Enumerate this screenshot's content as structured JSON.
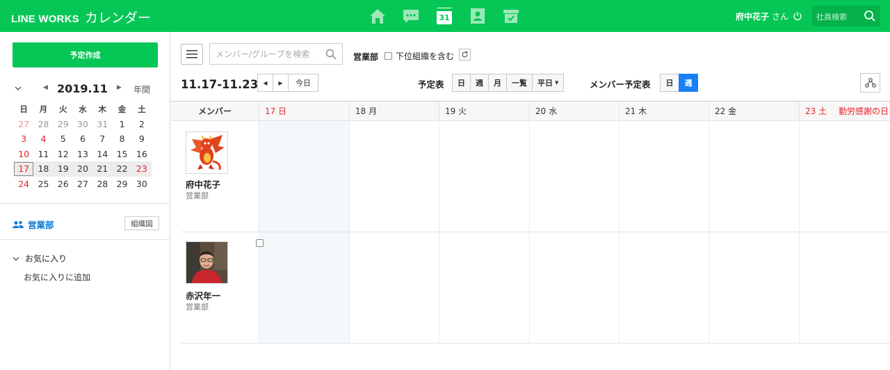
{
  "header": {
    "logo": "LINE WORKS",
    "app_title": "カレンダー",
    "calendar_icon_day": "31",
    "user_name": "府中花子",
    "user_suffix": "さん",
    "search_placeholder": "社員検索"
  },
  "sidebar": {
    "create_button": "予定作成",
    "mini_calendar": {
      "month_label": "2019.11",
      "year_view_label": "年間",
      "weekday_headers": [
        "日",
        "月",
        "火",
        "水",
        "木",
        "金",
        "土"
      ],
      "weeks": [
        [
          "27",
          "28",
          "29",
          "30",
          "31",
          "1",
          "2"
        ],
        [
          "3",
          "4",
          "5",
          "6",
          "7",
          "8",
          "9"
        ],
        [
          "10",
          "11",
          "12",
          "13",
          "14",
          "15",
          "16"
        ],
        [
          "17",
          "18",
          "19",
          "20",
          "21",
          "22",
          "23"
        ],
        [
          "24",
          "25",
          "26",
          "27",
          "28",
          "29",
          "30"
        ]
      ],
      "today": "17"
    },
    "department": "営業部",
    "org_chart_button": "組織図",
    "favorites_label": "お気に入り",
    "add_favorite": "お気に入りに追加"
  },
  "toolbar": {
    "member_search_placeholder": "メンバー/グループを検索",
    "department_label": "営業部",
    "include_sub_label": "下位組織を含む",
    "date_range": "11.17-11.23",
    "today_button": "今日",
    "schedule_label": "予定表",
    "view_buttons": [
      "日",
      "週",
      "月",
      "一覧",
      "平日"
    ],
    "member_schedule_label": "メンバー予定表",
    "member_view_buttons": [
      "日",
      "週"
    ],
    "member_view_active": "週"
  },
  "grid": {
    "member_header": "メンバー",
    "days": [
      "17 日",
      "18 月",
      "19 火",
      "20 水",
      "21 木",
      "22 金",
      "23 土"
    ],
    "holiday_label": "勤労感謝の日",
    "members": [
      {
        "name": "府中花子",
        "department": "営業部"
      },
      {
        "name": "赤沢年一",
        "department": "営業部"
      }
    ]
  },
  "colors": {
    "brand_green": "#06c755",
    "holiday_red": "#e8212a",
    "active_blue": "#1a7ff5",
    "link_blue": "#0a7ad6"
  },
  "icons": [
    "home-icon",
    "message-icon",
    "calendar-icon",
    "contacts-icon",
    "drive-icon",
    "power-icon",
    "search-icon",
    "menu-icon",
    "refresh-icon",
    "share-icon",
    "users-icon",
    "chevron-down-icon"
  ]
}
